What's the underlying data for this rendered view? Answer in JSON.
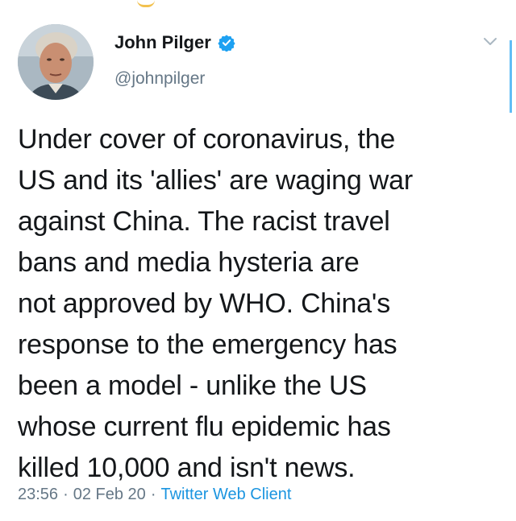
{
  "tweet": {
    "author": {
      "display_name": "John Pilger",
      "handle": "@johnpilger",
      "verified": true
    },
    "text_lines": [
      "Under cover of coronavirus, the",
      "US and its 'allies' are waging war",
      "against China. The racist travel",
      "bans and media hysteria are",
      "not approved by WHO. China's",
      "response to the emergency has",
      "been a model - unlike the US",
      "whose current flu epidemic has",
      "killed 10,000 and isn't news."
    ],
    "time": "23:56",
    "separator": "·",
    "date": "02 Feb 20",
    "client": "Twitter Web Client"
  },
  "colors": {
    "text": "#14171a",
    "secondary": "#657786",
    "link": "#1b95e0",
    "verified_badge": "#1da1f2"
  },
  "icons": {
    "verified": "verified-badge-icon",
    "menu": "chevron-down-icon"
  }
}
